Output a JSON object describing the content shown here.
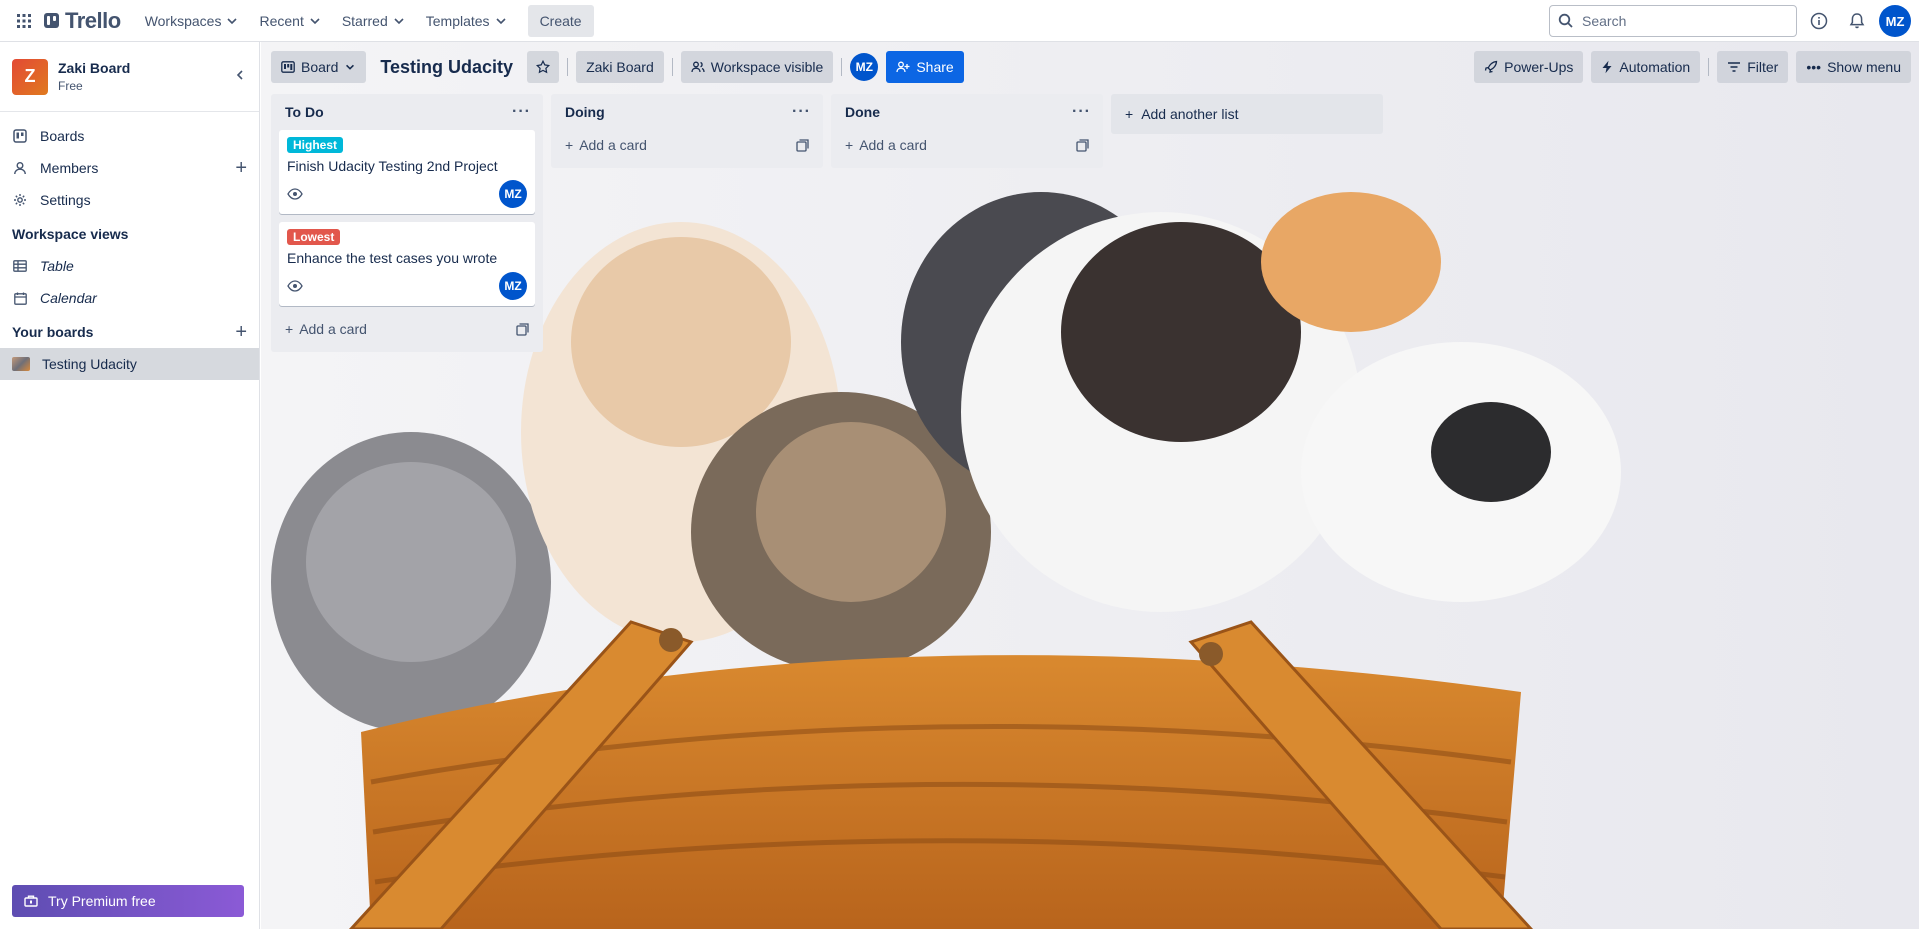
{
  "topnav": {
    "logo": "Trello",
    "menus": [
      "Workspaces",
      "Recent",
      "Starred",
      "Templates"
    ],
    "create": "Create",
    "search_placeholder": "Search",
    "avatar": "MZ"
  },
  "sidebar": {
    "workspace": {
      "initial": "Z",
      "name": "Zaki Board",
      "plan": "Free"
    },
    "items": [
      {
        "label": "Boards",
        "icon": "trello-board-icon"
      },
      {
        "label": "Members",
        "icon": "person-icon"
      },
      {
        "label": "Settings",
        "icon": "gear-icon"
      }
    ],
    "views_title": "Workspace views",
    "views": [
      {
        "label": "Table",
        "icon": "table-icon"
      },
      {
        "label": "Calendar",
        "icon": "calendar-icon"
      }
    ],
    "your_boards": "Your boards",
    "boards": [
      {
        "label": "Testing Udacity"
      }
    ],
    "premium": "Try Premium free"
  },
  "board": {
    "view_switch": "Board",
    "title": "Testing Udacity",
    "workspace_btn": "Zaki Board",
    "visibility": "Workspace visible",
    "member_avatar": "MZ",
    "share": "Share",
    "powerups": "Power-Ups",
    "automation": "Automation",
    "filter": "Filter",
    "show_menu": "Show menu",
    "add_list": "Add another list",
    "lists": [
      {
        "title": "To Do",
        "add_card": "Add a card",
        "cards": [
          {
            "label": "Highest",
            "label_color": "#00b8d9",
            "title": "Finish Udacity Testing 2nd Project",
            "member": "MZ"
          },
          {
            "label": "Lowest",
            "label_color": "#e2574c",
            "title": "Enhance the test cases you wrote",
            "member": "MZ"
          }
        ]
      },
      {
        "title": "Doing",
        "add_card": "Add a card",
        "cards": []
      },
      {
        "title": "Done",
        "add_card": "Add a card",
        "cards": []
      }
    ]
  },
  "colors": {
    "accent": "#0c66e4",
    "premium": "#6e5dc6"
  }
}
